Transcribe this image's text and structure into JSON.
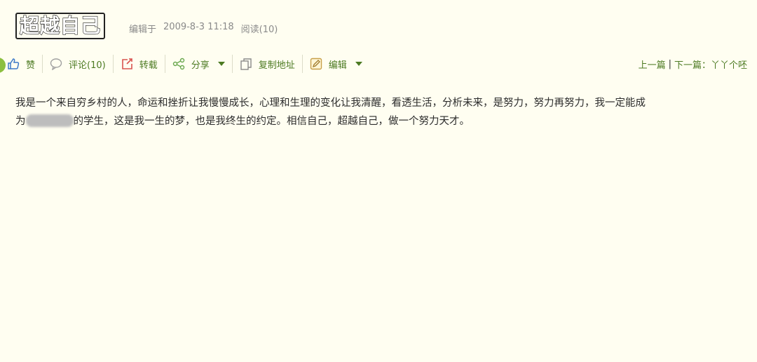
{
  "post": {
    "title": "超越自己",
    "meta_prefix": "编辑于",
    "date": "2009-8-3 11:18",
    "read_count": "阅读(10)"
  },
  "toolbar": {
    "like_label": "赞",
    "comment_label": "评论(10)",
    "repost_label": "转载",
    "share_label": "分享",
    "copy_label": "复制地址",
    "edit_label": "编辑"
  },
  "nav": {
    "prev_label": "上一篇",
    "separator": "|",
    "next_label": "下一篇：丫丫个呸"
  },
  "content": {
    "line1": "我是一个来自穷乡村的人，命运和挫折让我慢慢成长，心理和生理的变化让我清醒，看透生活，分析未来，是努力，努力再努力，我一定能成",
    "line2_prefix": "为",
    "line2_suffix": "的学生，这是我一生的梦，也是我终生的约定。相信自己，超越自己，做一个努力天才。"
  },
  "colors": {
    "background": "#fffef1",
    "link_green": "#4c7a22",
    "meta_gray": "#8a8a8a",
    "icon_blue": "#3c78c8",
    "icon_red": "#d9534f"
  },
  "icons": [
    "thumbs-up-icon",
    "comment-bubble-icon",
    "repost-icon",
    "share-icon",
    "copy-icon",
    "edit-icon",
    "chevron-down-icon"
  ]
}
